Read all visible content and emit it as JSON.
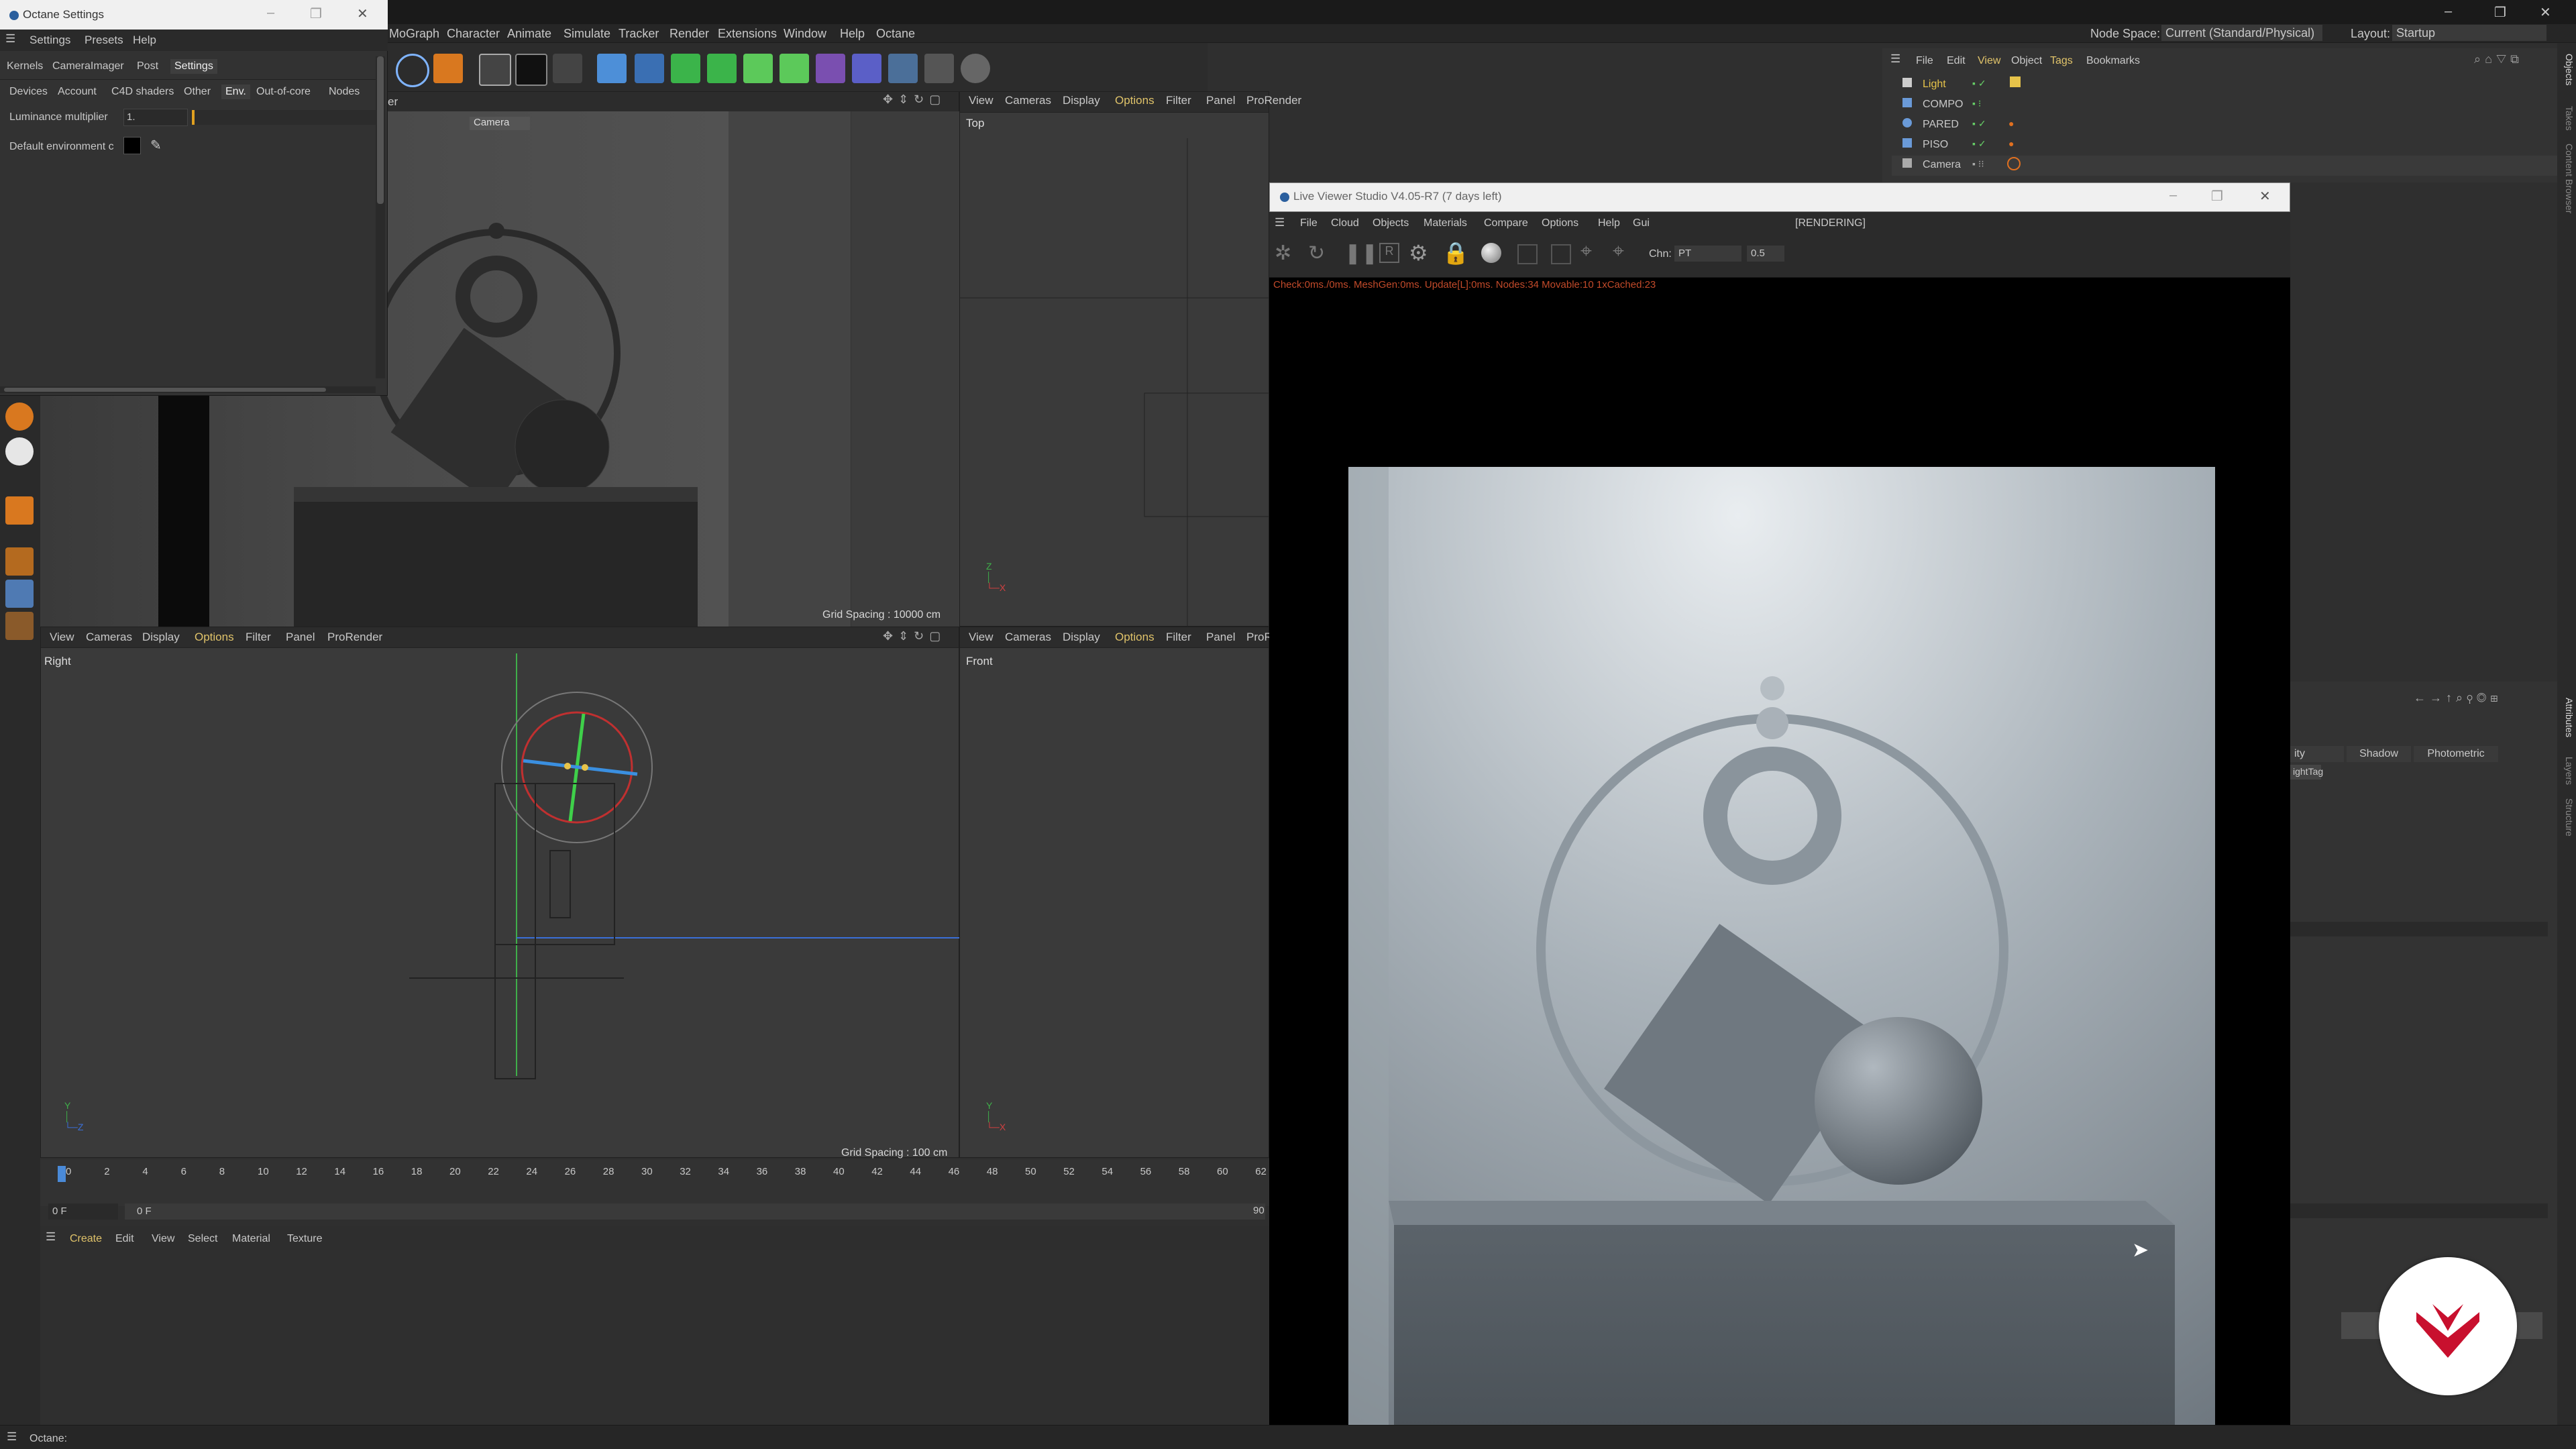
{
  "window": {
    "minimize": "–",
    "restore": "❐",
    "close": "✕"
  },
  "main_menu": {
    "items": [
      "MoGraph",
      "Character",
      "Animate",
      "Simulate",
      "Tracker",
      "Render",
      "Extensions",
      "Window",
      "Help",
      "Octane"
    ],
    "node_space_label": "Node Space:",
    "node_space_value": "Current (Standard/Physical)",
    "layout_label": "Layout:",
    "layout_value": "Startup"
  },
  "octane_settings": {
    "title": "Octane Settings",
    "menu": [
      "Settings",
      "Presets",
      "Help"
    ],
    "tabs": [
      "Kernels",
      "CameraImager",
      "Post",
      "Settings"
    ],
    "subtabs": [
      "Devices",
      "Account",
      "C4D shaders",
      "Other",
      "Env.",
      "Out-of-core",
      "Nodes"
    ],
    "luminance_label": "Luminance multiplier",
    "luminance_value": "1.",
    "default_env_label": "Default environment c"
  },
  "viewports": {
    "menu": [
      "View",
      "Cameras",
      "Display",
      "Options",
      "Filter",
      "Panel",
      "ProRender"
    ],
    "perspective": {
      "partial_label": "er",
      "camera_tag": "Camera",
      "grid": "Grid Spacing : 10000 cm"
    },
    "top": {
      "name": "Top"
    },
    "right": {
      "name": "Right",
      "grid": "Grid Spacing : 100 cm"
    },
    "front": {
      "name": "Front",
      "partial_menu": "ProR"
    }
  },
  "objects": {
    "menu": [
      "File",
      "Edit",
      "View",
      "Object",
      "Tags",
      "Bookmarks"
    ],
    "items": [
      {
        "name": "Light",
        "color": "#e6c34a"
      },
      {
        "name": "COMPO",
        "color": "#c8c8c8"
      },
      {
        "name": "PARED",
        "color": "#c8c8c8"
      },
      {
        "name": "PISO",
        "color": "#c8c8c8"
      },
      {
        "name": "Camera",
        "color": "#c8c8c8"
      }
    ]
  },
  "live_viewer": {
    "title": "Live Viewer Studio V4.05-R7 (7 days left)",
    "menu": [
      "File",
      "Cloud",
      "Objects",
      "Materials",
      "Compare",
      "Options",
      "Help",
      "Gui"
    ],
    "status": "[RENDERING]",
    "chn_label": "Chn:",
    "chn_value": "PT",
    "zoom_value": "0.5",
    "stats": "Check:0ms./0ms. MeshGen:0ms. Update[L]:0ms. Nodes:34 Movable:10 1xCached:23"
  },
  "attributes": {
    "tabs": [
      "ity",
      "Shadow",
      "Photometric"
    ],
    "tag": "ightTag"
  },
  "timeline": {
    "ticks": [
      "0",
      "2",
      "4",
      "6",
      "8",
      "10",
      "12",
      "14",
      "16",
      "18",
      "20",
      "22",
      "24",
      "26",
      "28",
      "30",
      "32",
      "34",
      "36",
      "38",
      "40",
      "42",
      "44",
      "46",
      "48",
      "50",
      "52",
      "54",
      "56",
      "58",
      "60",
      "62"
    ],
    "current_frame": "0 F",
    "range_start": "0 F",
    "end": "90"
  },
  "material_manager": {
    "menu": [
      "Create",
      "Edit",
      "View",
      "Select",
      "Material",
      "Texture"
    ]
  },
  "side_tabs": [
    "Objects",
    "Takes",
    "Content Browser",
    "Attributes",
    "Layers",
    "Structure"
  ],
  "status_bar": {
    "text": "Octane:"
  },
  "colors": {
    "accent": "#e0c36a",
    "brand": "#c8102e"
  }
}
